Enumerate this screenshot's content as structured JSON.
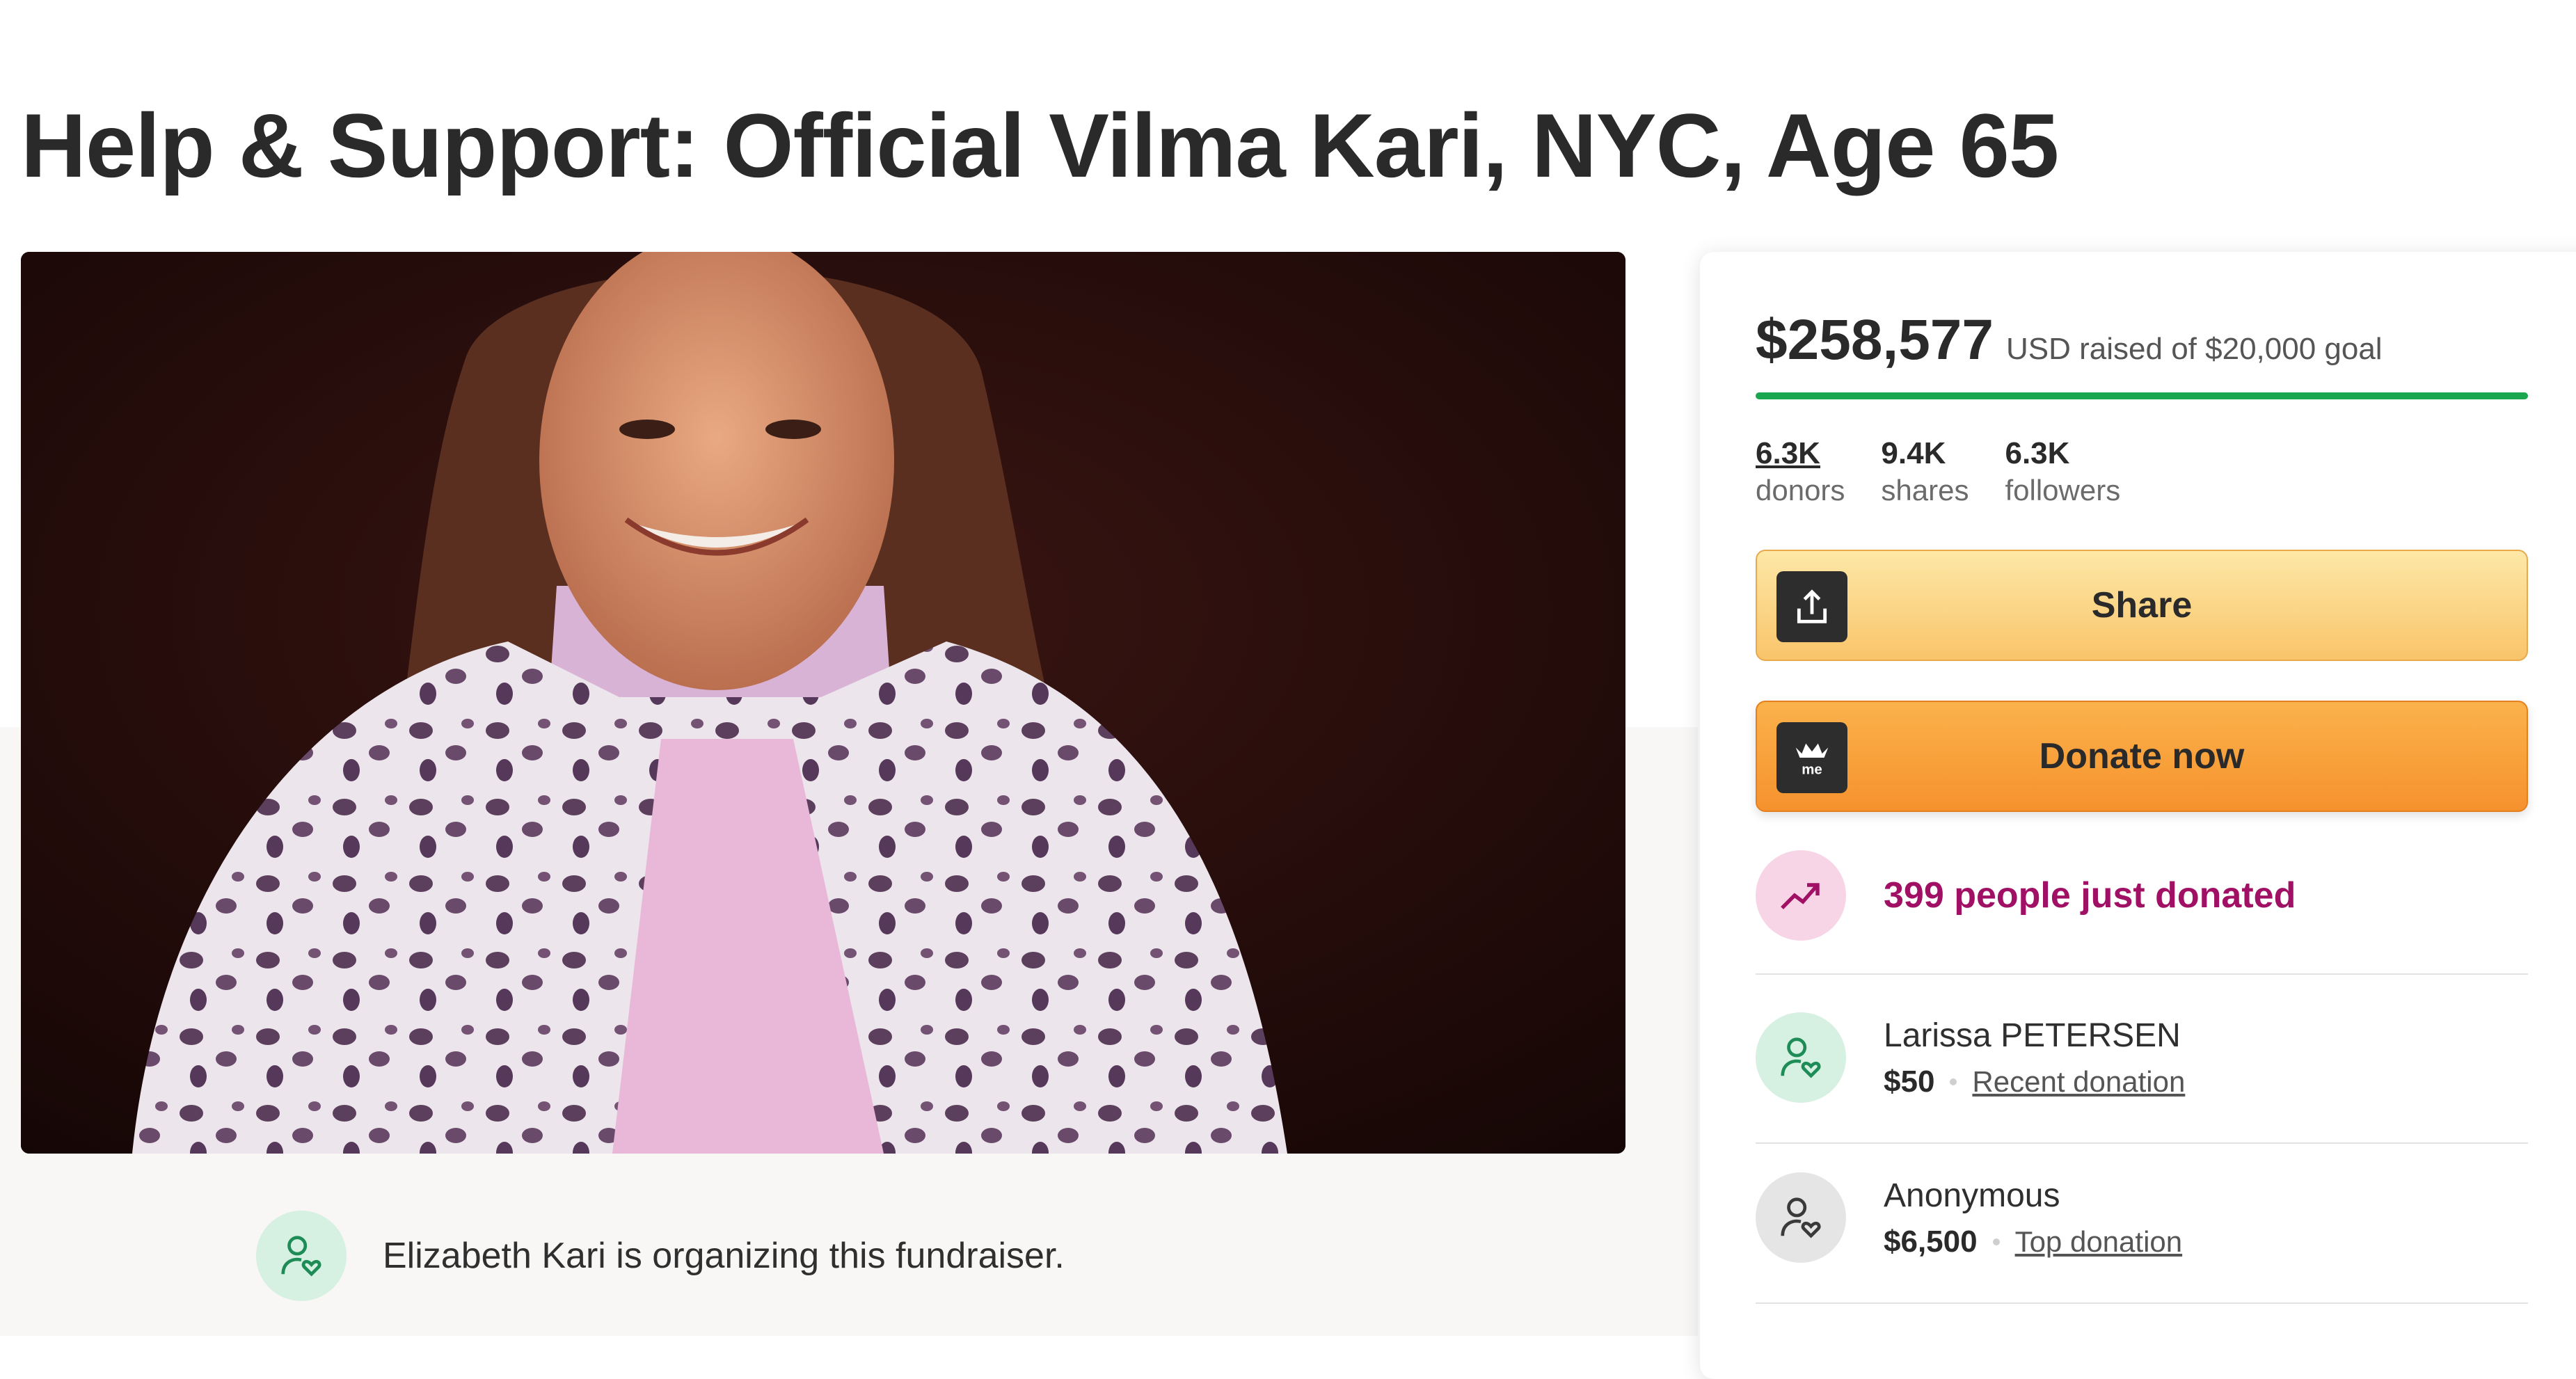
{
  "page": {
    "title": "Help & Support: Official Vilma Kari, NYC, Age 65"
  },
  "organizer": {
    "text": "Elizabeth Kari is organizing this fundraiser.",
    "icon": "user-heart-icon"
  },
  "donation_panel": {
    "amount_raised": "$258,577",
    "goal_text": "USD raised of $20,000 goal",
    "progress_fraction": 1.0,
    "stats": [
      {
        "value": "6.3K",
        "label": "donors"
      },
      {
        "value": "9.4K",
        "label": "shares"
      },
      {
        "value": "6.3K",
        "label": "followers"
      }
    ],
    "share_label": "Share",
    "donate_label": "Donate now",
    "recent_activity": "399 people just donated",
    "donations": [
      {
        "name": "Larissa PETERSEN",
        "amount": "$50",
        "tag": "Recent donation"
      },
      {
        "name": "Anonymous",
        "amount": "$6,500",
        "tag": "Top donation"
      }
    ]
  },
  "colors": {
    "progress": "#1aa74f",
    "share_button": "#f9c46a",
    "donate_button": "#f6922e",
    "recent_text": "#a01064"
  }
}
